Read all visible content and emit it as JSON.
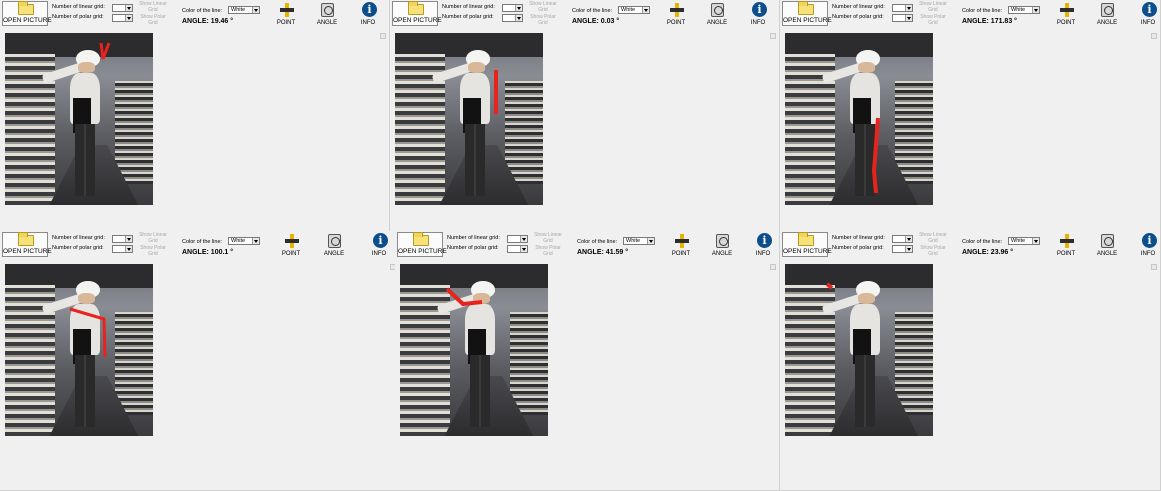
{
  "toolbar": {
    "open_picture_label": "OPEN PICTURE",
    "linear_grid_label": "Number of linear grid:",
    "polar_grid_label": "Number of polar grid:",
    "show_linear_grid_label": "Show Linear Grid",
    "show_polar_grid_label": "Show Polar Grid",
    "line_color_label": "Color of the line:",
    "line_color_value": "White",
    "angle_prefix": "ANGLE:",
    "point_label": "POINT",
    "angle_button_label": "ANGLE",
    "info_label": "INFO"
  },
  "icons": [
    "folder-icon",
    "point-icon",
    "angle-icon",
    "info-icon"
  ],
  "accent_color": "#e8231e",
  "panels": [
    {
      "angle": "19.46 °"
    },
    {
      "angle": "0.03 °"
    },
    {
      "angle": "171.83 °"
    },
    {
      "angle": "100.1 °"
    },
    {
      "angle": "41.59 °"
    },
    {
      "angle": "23.96 °"
    }
  ]
}
